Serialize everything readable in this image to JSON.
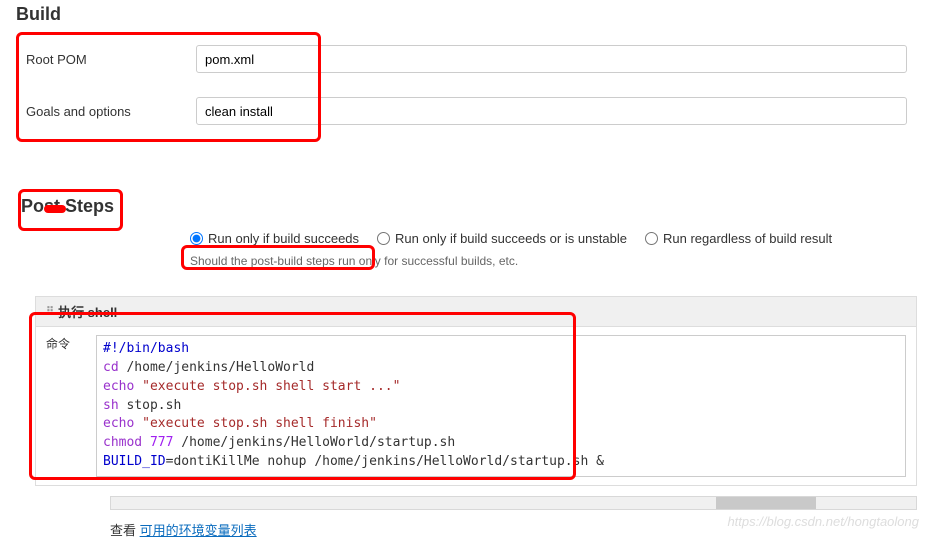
{
  "build": {
    "title": "Build",
    "root_pom_label": "Root POM",
    "root_pom_value": "pom.xml",
    "goals_label": "Goals and options",
    "goals_value": "clean install"
  },
  "post_steps": {
    "title": "Post Steps",
    "radio_options": {
      "succeeds": "Run only if build succeeds",
      "unstable": "Run only if build succeeds or is unstable",
      "regardless": "Run regardless of build result"
    },
    "selected": "succeeds",
    "help_text": "Should the post-build steps run only for successful builds, etc."
  },
  "shell": {
    "header": "执行 shell",
    "cmd_label": "命令",
    "lines": {
      "shebang_pre": "#!",
      "shebang_path": "/bin/bash",
      "cd": "cd",
      "cd_path": " /home/jenkins/HelloWorld",
      "echo1": "echo",
      "echo1_str": " \"execute stop.sh shell start ...\"",
      "sh": "sh",
      "sh_arg": " stop.sh",
      "echo2": "echo",
      "echo2_str": " \"execute stop.sh shell finish\"",
      "chmod": "chmod",
      "chmod_num": " 777",
      "chmod_path": " /home/jenkins/HelloWorld/startup.sh",
      "envset": "BUILD_ID",
      "env_rest": "=dontiKillMe nohup /home/jenkins/HelloWorld/startup.sh &"
    }
  },
  "footer": {
    "text_prefix": "查看 ",
    "link_text": "可用的环境变量列表"
  },
  "watermark": "https://blog.csdn.net/hongtaolong"
}
